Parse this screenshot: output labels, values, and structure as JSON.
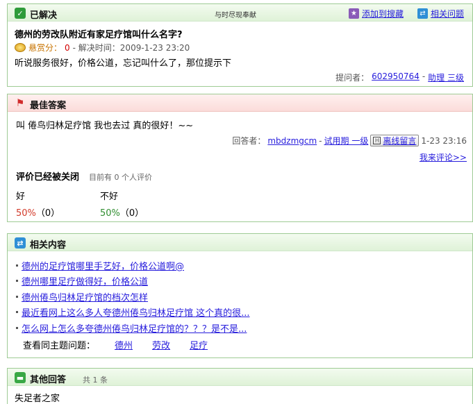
{
  "solved": {
    "title": "已解决",
    "center_text": "与时尽现奉献",
    "add_favorite": "添加到搜藏",
    "related_questions": "相关问题",
    "question_title": "德州的劳改队附近有家足疗馆叫什么名字?",
    "reward_label": "悬赏分：",
    "reward_value": "0",
    "solved_time": "- 解决时间：2009-1-23 23:20",
    "question_body": "听说服务很好，价格公道，忘记叫什么了，那位提示下",
    "asker_label": "提问者：",
    "asker_name": "602950764",
    "asker_sep": "-",
    "asker_level": "助理 三级"
  },
  "best": {
    "title": "最佳答案",
    "answer": "叫 倦鸟归林足疗馆 我也去过 真的很好！~~",
    "responder_label": "回答者：",
    "responder_name": "mbdzmgcm",
    "responder_sep": "-",
    "responder_level": "试用期 一级",
    "message_button": "离线留言",
    "answer_time": "1-23 23:16",
    "comment_link": "我来评论>>",
    "rating_closed": "评价已经被关闭",
    "rating_count": "目前有 0 个人评价",
    "good_label": "好",
    "bad_label": "不好",
    "good_pct": "50%",
    "good_count": "（0）",
    "bad_pct": "50%",
    "bad_count": "（0）"
  },
  "related": {
    "title": "相关内容",
    "items": [
      "德州的足疗馆哪里手艺好，价格公道啊@",
      "德州哪里足疗做得好，价格公道",
      "德州倦鸟归林足疗馆的档次怎样",
      "最近看网上这么多人夸德州倦鸟归林足疗馆 这个真的很...",
      "怎么网上怎么多夸德州倦鸟归林足疗馆的？？？是不是..."
    ],
    "topics_label": "查看同主题问题：",
    "topics": [
      "德州",
      "劳改",
      "足疗"
    ]
  },
  "other": {
    "title": "其他回答",
    "count": "共 1 条",
    "answer": "失足者之家"
  },
  "colors": {
    "panel_border": "#9ecb94",
    "link": "#261cdc",
    "best_header": "#fbdcda"
  }
}
